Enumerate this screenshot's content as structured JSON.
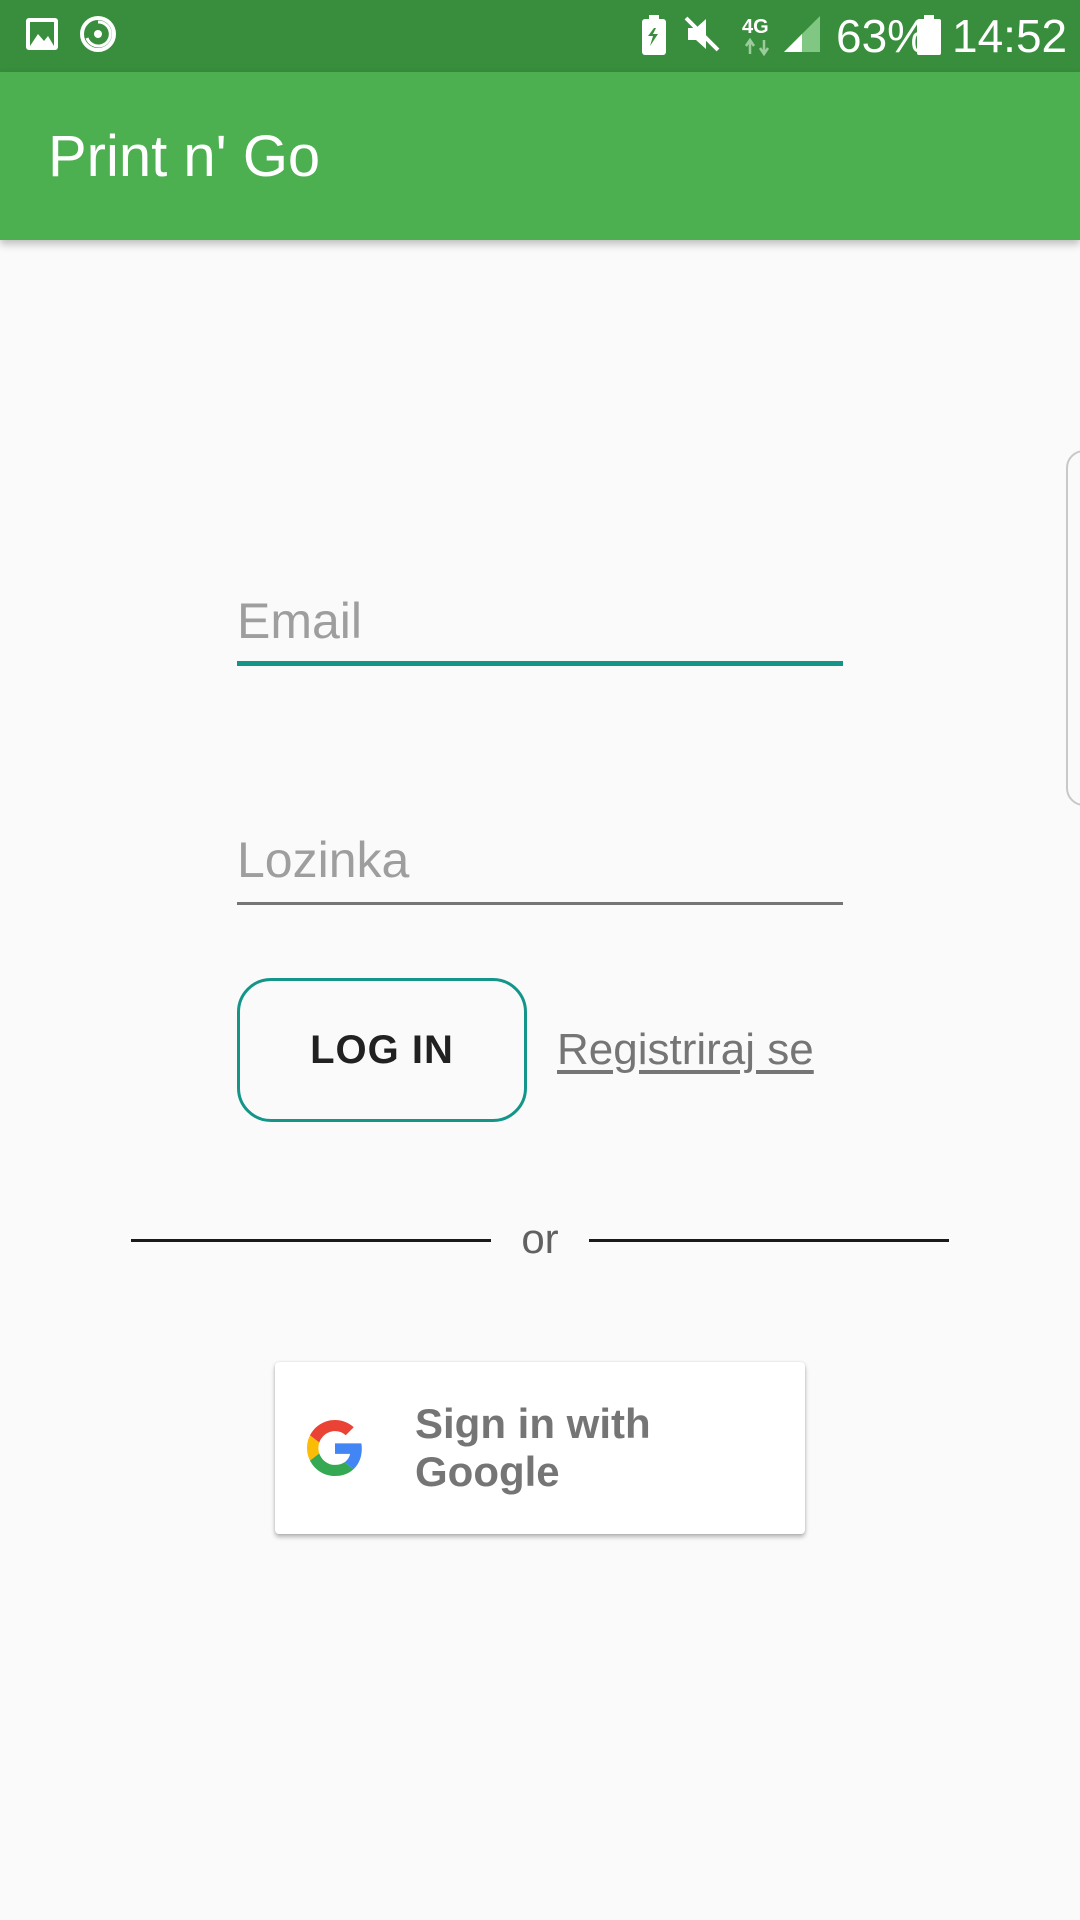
{
  "status_bar": {
    "battery_percent": "63%",
    "time": "14:52",
    "network_type": "4G",
    "icons": [
      "gallery-icon",
      "sync-icon",
      "battery-saver-icon",
      "mute-icon",
      "network-4g-icon",
      "signal-icon",
      "battery-icon"
    ]
  },
  "app_bar": {
    "title": "Print n' Go"
  },
  "login_form": {
    "email_placeholder": "Email",
    "email_value": "",
    "password_placeholder": "Lozinka",
    "password_value": "",
    "login_label": "LOG IN",
    "register_label": "Registriraj se"
  },
  "divider": {
    "label": "or"
  },
  "google_sign_in": {
    "label": "Sign in with Google",
    "icon": "google-icon"
  },
  "colors": {
    "status_bar": "#388e3c",
    "app_bar": "#4caf50",
    "accent": "#139689",
    "background": "#fafafa"
  }
}
